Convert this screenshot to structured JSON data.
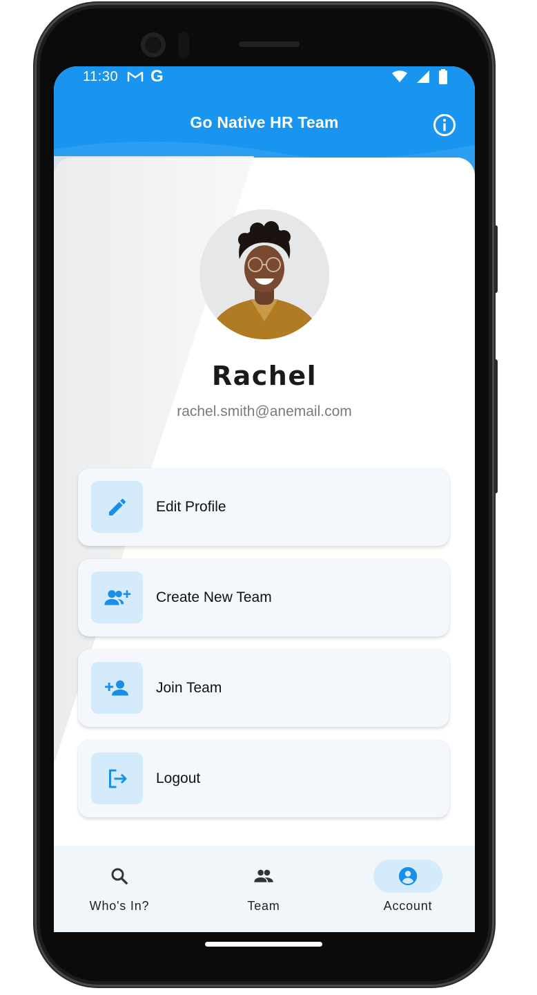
{
  "status_bar": {
    "time": "11:30",
    "gmail_glyph": "M",
    "google_glyph": "G",
    "icons": [
      "wifi-icon",
      "signal-icon",
      "battery-icon"
    ]
  },
  "header": {
    "title": "Go Native HR Team",
    "info_icon": "info-icon"
  },
  "profile": {
    "name": "Rachel",
    "email": "rachel.smith@anemail.com"
  },
  "menu": [
    {
      "label": "Edit Profile",
      "icon": "pencil-icon"
    },
    {
      "label": "Create New Team",
      "icon": "group-add-icon"
    },
    {
      "label": "Join Team",
      "icon": "person-add-icon"
    },
    {
      "label": "Logout",
      "icon": "logout-icon"
    }
  ],
  "bottom_nav": [
    {
      "label": "Who's In?",
      "icon": "search-icon",
      "active": false
    },
    {
      "label": "Team",
      "icon": "people-icon",
      "active": false
    },
    {
      "label": "Account",
      "icon": "account-circle-icon",
      "active": true
    }
  ],
  "colors": {
    "brand_blue": "#1a95ef",
    "icon_blue": "#1a8fe8",
    "icon_tile": "#d3ebfa",
    "card_bg": "#f4f8fc",
    "nav_bg": "#f1f6fb",
    "active_pill": "#d3ebfa"
  }
}
